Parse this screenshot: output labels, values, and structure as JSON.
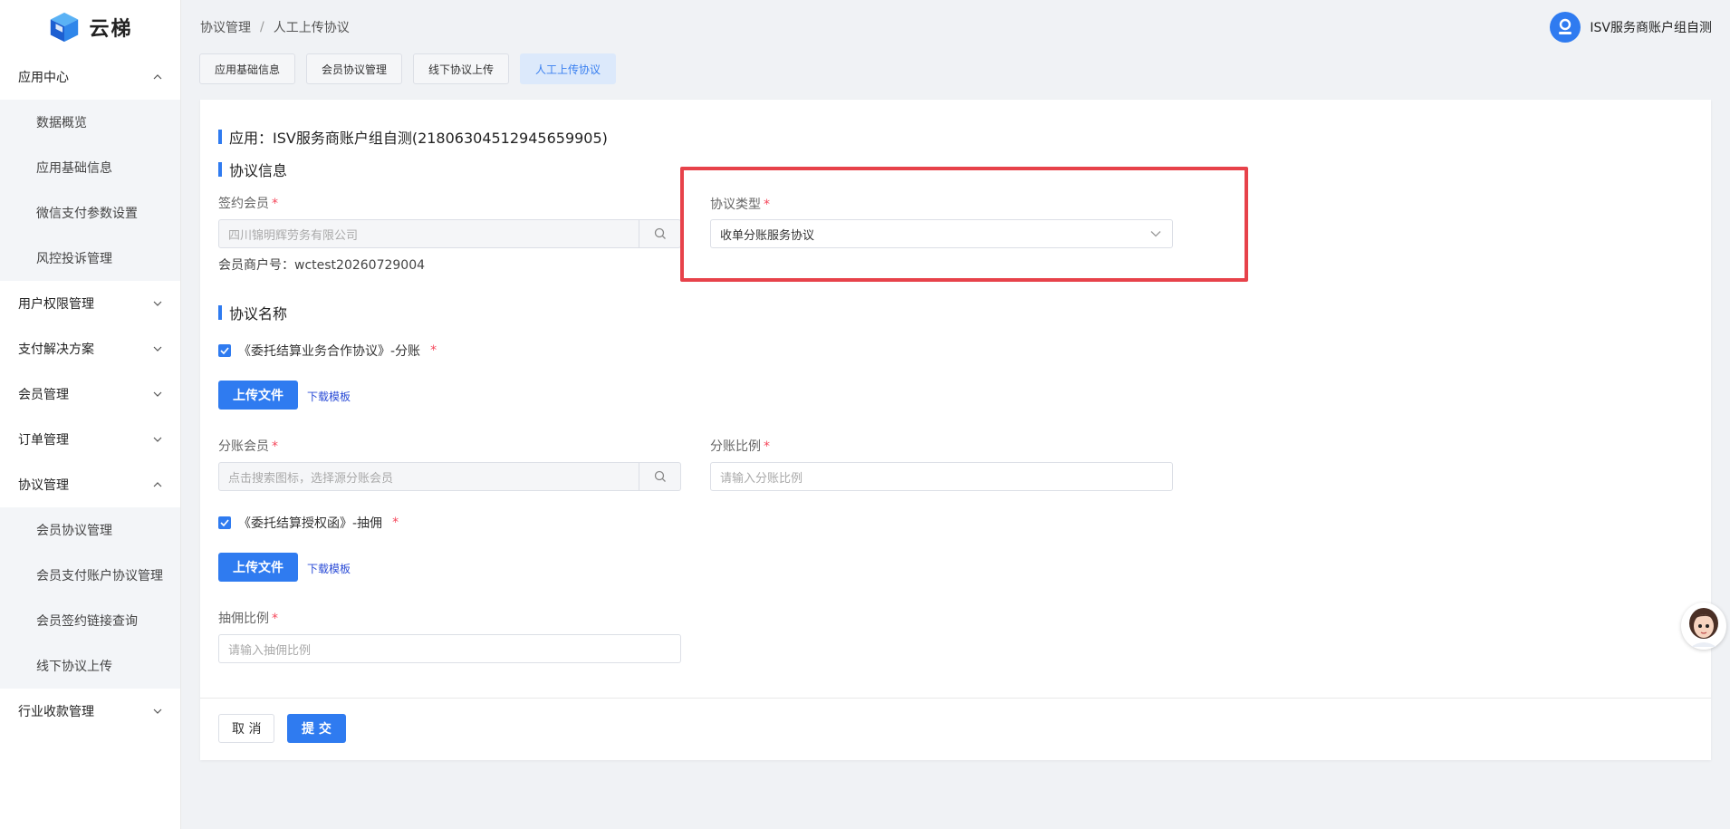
{
  "logo": {
    "text": "云梯"
  },
  "sidebar": {
    "groups": [
      {
        "label": "应用中心",
        "expanded": true,
        "items": [
          "数据概览",
          "应用基础信息",
          "微信支付参数设置",
          "风控投诉管理"
        ]
      },
      {
        "label": "用户权限管理",
        "expanded": false,
        "items": []
      },
      {
        "label": "支付解决方案",
        "expanded": false,
        "items": []
      },
      {
        "label": "会员管理",
        "expanded": false,
        "items": []
      },
      {
        "label": "订单管理",
        "expanded": false,
        "items": []
      },
      {
        "label": "协议管理",
        "expanded": true,
        "items": [
          "会员协议管理",
          "会员支付账户协议管理",
          "会员签约链接查询",
          "线下协议上传"
        ]
      },
      {
        "label": "行业收款管理",
        "expanded": false,
        "items": []
      }
    ]
  },
  "header": {
    "breadcrumb": [
      "协议管理",
      "人工上传协议"
    ],
    "separator": "/",
    "user_name": "ISV服务商账户组自测"
  },
  "tabs": [
    {
      "label": "应用基础信息",
      "active": false
    },
    {
      "label": "会员协议管理",
      "active": false
    },
    {
      "label": "线下协议上传",
      "active": false
    },
    {
      "label": "人工上传协议",
      "active": true
    }
  ],
  "form": {
    "app_title": "应用：ISV服务商账户组自测(21806304512945659905)",
    "section_agreement_info": "协议信息",
    "signing_member_label": "签约会员",
    "signing_member_value": "四川锦明辉劳务有限公司",
    "merchant_no": "会员商户号：wctest20260729004",
    "agreement_type_label": "协议类型",
    "agreement_type_value": "收单分账服务协议",
    "section_agreement_name": "协议名称",
    "agreement1_label": "《委托结算业务合作协议》-分账",
    "agreement1_checked": true,
    "upload_label": "上传文件",
    "download_template": "下载模板",
    "split_member_label": "分账会员",
    "split_member_placeholder": "点击搜索图标，选择源分账会员",
    "split_ratio_label": "分账比例",
    "split_ratio_placeholder": "请输入分账比例",
    "agreement2_label": "《委托结算授权函》-抽佣",
    "agreement2_checked": true,
    "commission_ratio_label": "抽佣比例",
    "commission_ratio_placeholder": "请输入抽佣比例",
    "required_mark": "*"
  },
  "footer": {
    "cancel_label": "取 消",
    "submit_label": "提 交"
  },
  "colors": {
    "primary": "#2f7bf0",
    "required": "#f5475b",
    "highlight": "#e7424a",
    "link": "#2a4bd6"
  }
}
